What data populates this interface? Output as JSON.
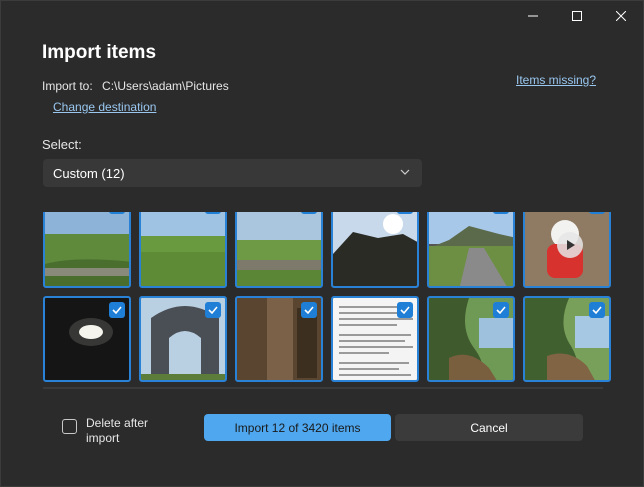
{
  "dialog": {
    "title": "Import items",
    "import_to_label": "Import to:",
    "import_path": "C:\\Users\\adam\\Pictures",
    "change_destination": "Change destination",
    "items_missing": "Items missing?",
    "select_label": "Select:",
    "select_value": "Custom (12)",
    "delete_after_import": "Delete after import",
    "delete_checked": false,
    "import_button": "Import 12 of 3420 items",
    "cancel_button": "Cancel"
  },
  "thumbnails": [
    {
      "desc": "green hillside with dry stone wall",
      "selected": true
    },
    {
      "desc": "grassy field with stone wall",
      "selected": true
    },
    {
      "desc": "rolling fields with stone wall",
      "selected": true
    },
    {
      "desc": "dark rocky outcrop with sun",
      "selected": true
    },
    {
      "desc": "country road toward hill",
      "selected": true
    },
    {
      "desc": "white dog in red sweater",
      "selected": true,
      "video": true
    },
    {
      "desc": "ceiling light in dark room",
      "selected": true
    },
    {
      "desc": "stone arch monument",
      "selected": true
    },
    {
      "desc": "close-up of tree bark",
      "selected": true
    },
    {
      "desc": "phone screenshot of text",
      "selected": true
    },
    {
      "desc": "tree with gnarled roots by lake",
      "selected": true
    },
    {
      "desc": "tree with gnarled roots by water",
      "selected": true
    }
  ],
  "colors": {
    "accent": "#4ea7ef",
    "selection": "#2a82d6",
    "background": "#2b2b2b"
  }
}
